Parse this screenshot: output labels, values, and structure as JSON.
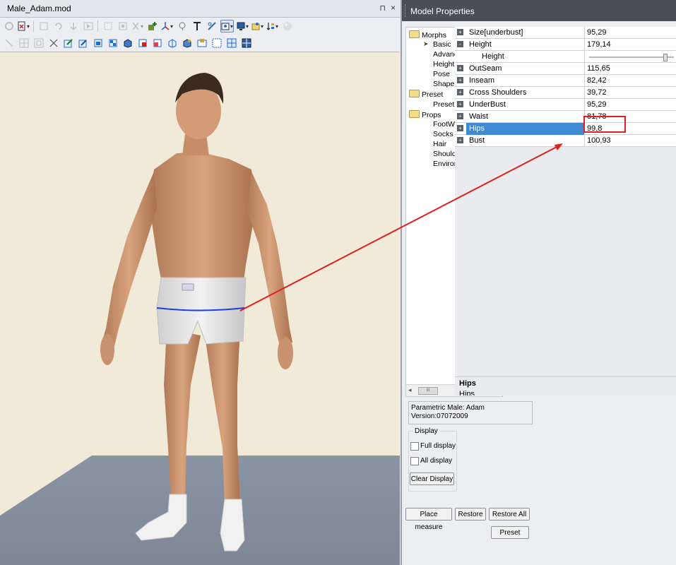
{
  "document": {
    "tab_title": "Male_Adam.mod",
    "pin_glyph": "⊓",
    "close_glyph": "×"
  },
  "toolbar": {
    "row1": [
      "recycle-icon",
      "file-export-icon",
      "copy-icon",
      "undo-icon",
      "redo-icon",
      "play-icon",
      "fit-icon",
      "select-icon",
      "expand-icon",
      "add-icon",
      "axis-icon",
      "lasso-icon",
      "text-tool-icon",
      "link-icon",
      "settings-icon",
      "monitor-icon",
      "folder-icon",
      "sort-icon",
      "sphere-icon"
    ],
    "row2": [
      "line-icon",
      "grid-icon",
      "transform-icon",
      "pointer-icon",
      "edit-icon",
      "edit-icon-2",
      "cube-icon",
      "cube-icon-2",
      "cube-icon-3",
      "cube-icon-4",
      "cube-icon-5",
      "cube-icon-6",
      "cube-icon-7",
      "cube-icon-8",
      "cube-icon-9",
      "cube-icon-10",
      "cube-icon-11"
    ]
  },
  "panel": {
    "title": "Model Properties"
  },
  "tree": {
    "items": [
      {
        "label": "Morphs",
        "type": "folder"
      },
      {
        "label": "Basic",
        "type": "leaf",
        "selected_arrow": true
      },
      {
        "label": "Advanc",
        "type": "leaf"
      },
      {
        "label": "Heights",
        "type": "leaf"
      },
      {
        "label": "Pose",
        "type": "leaf"
      },
      {
        "label": "Shape",
        "type": "leaf"
      },
      {
        "label": "Preset",
        "type": "folder"
      },
      {
        "label": "Preset",
        "type": "leaf"
      },
      {
        "label": "Props",
        "type": "folder"
      },
      {
        "label": "FootWe",
        "type": "leaf"
      },
      {
        "label": "Socks",
        "type": "leaf"
      },
      {
        "label": "Hair",
        "type": "leaf"
      },
      {
        "label": "Shoulde",
        "type": "leaf"
      },
      {
        "label": "Environ",
        "type": "leaf"
      }
    ],
    "scroll_thumb": "III"
  },
  "properties": {
    "rows": [
      {
        "label": "Size[underbust]",
        "value": "95,29",
        "expander": "+"
      },
      {
        "label": "Height",
        "value": "179,14",
        "expander": "-"
      },
      {
        "label": "Height",
        "value": "",
        "sub": true,
        "slider": true
      },
      {
        "label": "OutSeam",
        "value": "115,65",
        "expander": "+"
      },
      {
        "label": "Inseam",
        "value": "82,42",
        "expander": "+"
      },
      {
        "label": "Cross Shoulders",
        "value": "39,72",
        "expander": "+"
      },
      {
        "label": "UnderBust",
        "value": "95,29",
        "expander": "+"
      },
      {
        "label": "Waist",
        "value": "81,78",
        "expander": "+"
      },
      {
        "label": "Hips",
        "value": "99,8",
        "expander": "+",
        "selected": true
      },
      {
        "label": "Bust",
        "value": "100,93",
        "expander": "+"
      }
    ],
    "selection_color": "#3f8ad2"
  },
  "description": {
    "title": "Hips",
    "text": "Hips"
  },
  "model_info": {
    "line1": "Parametric Male: Adam",
    "line2": "Version:07072009"
  },
  "display": {
    "group_label": "Display",
    "full_display_label": "Full display",
    "all_display_label": "All display",
    "clear_display_label": "Clear Display"
  },
  "buttons": {
    "place_measure": "Place measure",
    "restore": "Restore",
    "restore_all": "Restore All",
    "preset": "Preset"
  },
  "annotation": {
    "color": "#e0201c",
    "measure_line_color": "#1d3fe0"
  }
}
